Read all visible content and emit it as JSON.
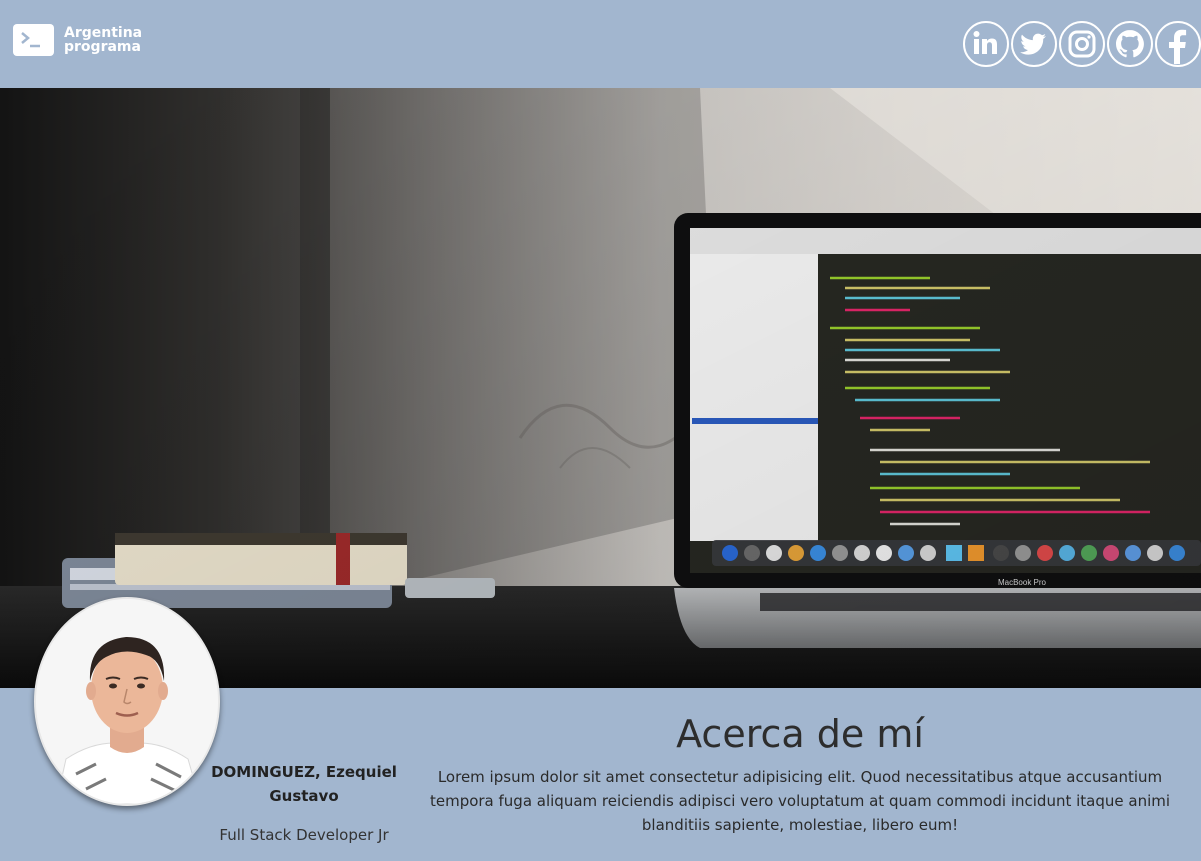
{
  "header": {
    "brand_line1": "Argentina",
    "brand_line2": "programa",
    "brand_icon": "terminal-icon",
    "socials": [
      {
        "name": "linkedin",
        "icon": "linkedin-icon"
      },
      {
        "name": "twitter",
        "icon": "twitter-icon"
      },
      {
        "name": "instagram",
        "icon": "instagram-icon"
      },
      {
        "name": "github",
        "icon": "github-icon"
      },
      {
        "name": "facebook",
        "icon": "facebook-icon"
      }
    ]
  },
  "hero": {
    "laptop_brand": "MacBook Pro"
  },
  "profile": {
    "name": "DOMINGUEZ, Ezequiel Gustavo",
    "role": "Full Stack Developer Jr"
  },
  "about": {
    "title": "Acerca de mí",
    "text": "Lorem ipsum dolor sit amet consectetur adipisicing elit. Quod necessitatibus atque accusantium tempora fuga aliquam reiciendis adipisci vero voluptatum at quam commodi incidunt itaque animi blanditiis sapiente, molestiae, libero eum!"
  },
  "colors": {
    "header_bg": "#a2b6cf",
    "text_dark": "#2d2d2d",
    "white": "#ffffff"
  }
}
